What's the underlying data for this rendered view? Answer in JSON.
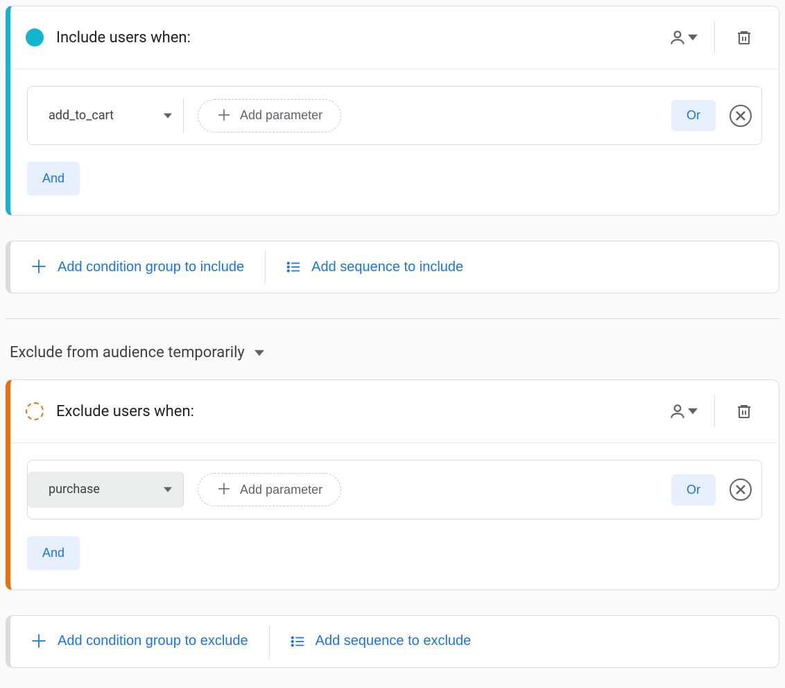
{
  "include": {
    "header_title": "Include users when:",
    "condition": {
      "event": "add_to_cart",
      "add_parameter_label": "Add parameter",
      "or_label": "Or"
    },
    "and_label": "And",
    "actions": {
      "add_group_label": "Add condition group to include",
      "add_sequence_label": "Add sequence to include"
    }
  },
  "exclude": {
    "mode_label": "Exclude from audience temporarily",
    "header_title": "Exclude users when:",
    "condition": {
      "event": "purchase",
      "add_parameter_label": "Add parameter",
      "or_label": "Or"
    },
    "and_label": "And",
    "actions": {
      "add_group_label": "Add condition group to exclude",
      "add_sequence_label": "Add sequence to exclude"
    }
  }
}
